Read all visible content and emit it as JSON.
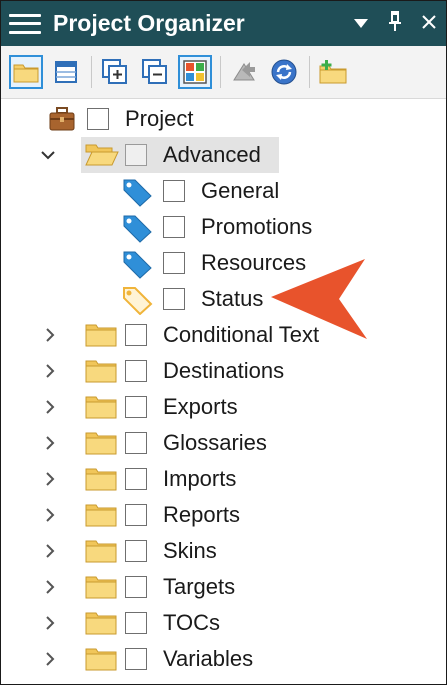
{
  "panel": {
    "title": "Project Organizer",
    "dropdown_glyph": "▼",
    "pin_glyph": "📌",
    "close_glyph": "✕"
  },
  "toolbar": {
    "buttons": [
      {
        "icon": "folder-icon",
        "active": true
      },
      {
        "icon": "table-view-icon",
        "active": false
      },
      {
        "icon": "expand-all-icon",
        "active": false
      },
      {
        "icon": "collapse-all-icon",
        "active": false
      },
      {
        "icon": "color-grid-icon",
        "active": true
      },
      {
        "icon": "move-icon",
        "active": false
      },
      {
        "icon": "refresh-icon",
        "active": false
      },
      {
        "icon": "new-folder-icon",
        "active": false
      }
    ]
  },
  "tree": {
    "project": {
      "label": "Project",
      "icon": "briefcase-icon"
    },
    "advanced": {
      "label": "Advanced",
      "icon": "open-folder-icon",
      "expanded": true,
      "selected": true
    },
    "advanced_children": [
      {
        "label": "General",
        "icon": "blue-tag-icon"
      },
      {
        "label": "Promotions",
        "icon": "blue-tag-icon"
      },
      {
        "label": "Resources",
        "icon": "blue-tag-icon"
      },
      {
        "label": "Status",
        "icon": "orange-tag-icon"
      }
    ],
    "folders": [
      {
        "label": "Conditional Text"
      },
      {
        "label": "Destinations"
      },
      {
        "label": "Exports"
      },
      {
        "label": "Glossaries"
      },
      {
        "label": "Imports"
      },
      {
        "label": "Reports"
      },
      {
        "label": "Skins"
      },
      {
        "label": "Targets"
      },
      {
        "label": "TOCs"
      },
      {
        "label": "Variables"
      }
    ]
  },
  "colors": {
    "titlebar": "#1f4e57",
    "arrow": "#e8532c",
    "folder": "#f5cf6a",
    "tag_blue": "#2f8fd8",
    "tag_orange": "#f0b43a"
  }
}
